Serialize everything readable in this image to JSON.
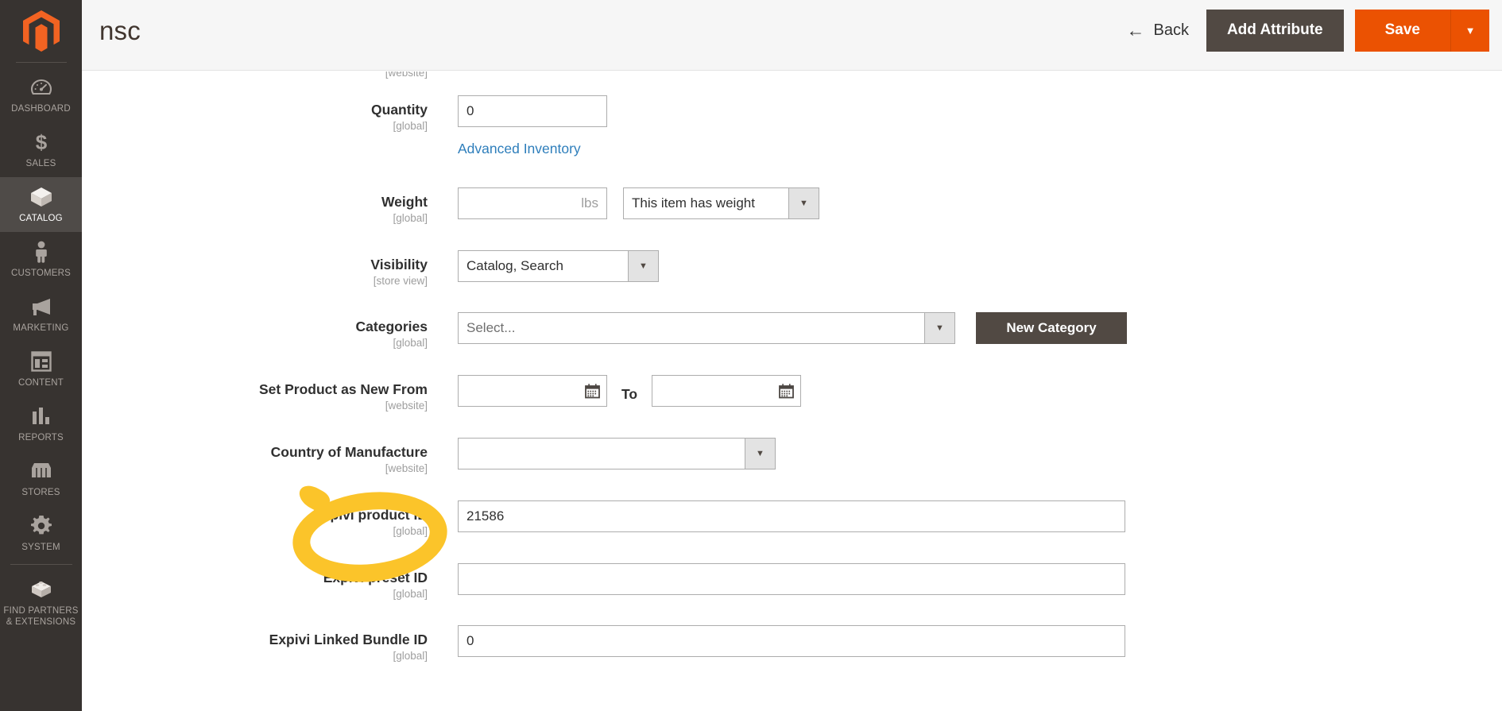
{
  "sidebar": {
    "logo": "magento-logo-icon",
    "items": [
      {
        "label": "DASHBOARD",
        "icon": "dashboard-icon",
        "active": false
      },
      {
        "label": "SALES",
        "icon": "dollar-icon",
        "active": false
      },
      {
        "label": "CATALOG",
        "icon": "box-icon",
        "active": true
      },
      {
        "label": "CUSTOMERS",
        "icon": "person-icon",
        "active": false
      },
      {
        "label": "MARKETING",
        "icon": "megaphone-icon",
        "active": false
      },
      {
        "label": "CONTENT",
        "icon": "layout-icon",
        "active": false
      },
      {
        "label": "REPORTS",
        "icon": "bar-chart-icon",
        "active": false
      },
      {
        "label": "STORES",
        "icon": "storefront-icon",
        "active": false
      },
      {
        "label": "SYSTEM",
        "icon": "gear-icon",
        "active": false
      },
      {
        "label": "FIND PARTNERS\n& EXTENSIONS",
        "icon": "blocks-icon",
        "active": false
      }
    ]
  },
  "header": {
    "title": "nsc",
    "back_label": "Back",
    "back_icon": "arrow-left-icon",
    "add_attribute_label": "Add Attribute",
    "save_label": "Save",
    "save_toggle_icon": "chevron-down-icon"
  },
  "form": {
    "fields": [
      {
        "label": "Quantity",
        "scope": "[global]",
        "value": "0",
        "link": "Advanced Inventory"
      },
      {
        "label": "Weight",
        "scope": "[global]",
        "value": "",
        "unit": "lbs",
        "select_value": "This item has weight"
      },
      {
        "label": "Visibility",
        "scope": "[store view]",
        "select_value": "Catalog, Search"
      },
      {
        "label": "Categories",
        "scope": "[global]",
        "select_value": "Select...",
        "button": "New Category"
      },
      {
        "label": "Set Product as New From",
        "scope": "[website]",
        "from_value": "",
        "to_label": "To",
        "to_value": "",
        "icon": "calendar-icon"
      },
      {
        "label": "Country of Manufacture",
        "scope": "[website]",
        "select_value": ""
      },
      {
        "label": "Expivi product ID",
        "scope": "[global]",
        "value": "21586"
      },
      {
        "label": "Expivi preset ID",
        "scope": "[global]",
        "value": ""
      },
      {
        "label": "Expivi Linked Bundle ID",
        "scope": "[global]",
        "value": "0"
      }
    ],
    "partial_top_scope": "[website]"
  },
  "annotation": {
    "type": "highlight-circle",
    "target": "Expivi product ID",
    "color": "#fbc42a"
  },
  "colors": {
    "sidebar_bg": "#373330",
    "sidebar_active": "#4f4b48",
    "brand_orange": "#eb5202",
    "dark_button": "#514943",
    "link_blue": "#2e7ebb",
    "highlight_yellow": "#fbc42a"
  }
}
